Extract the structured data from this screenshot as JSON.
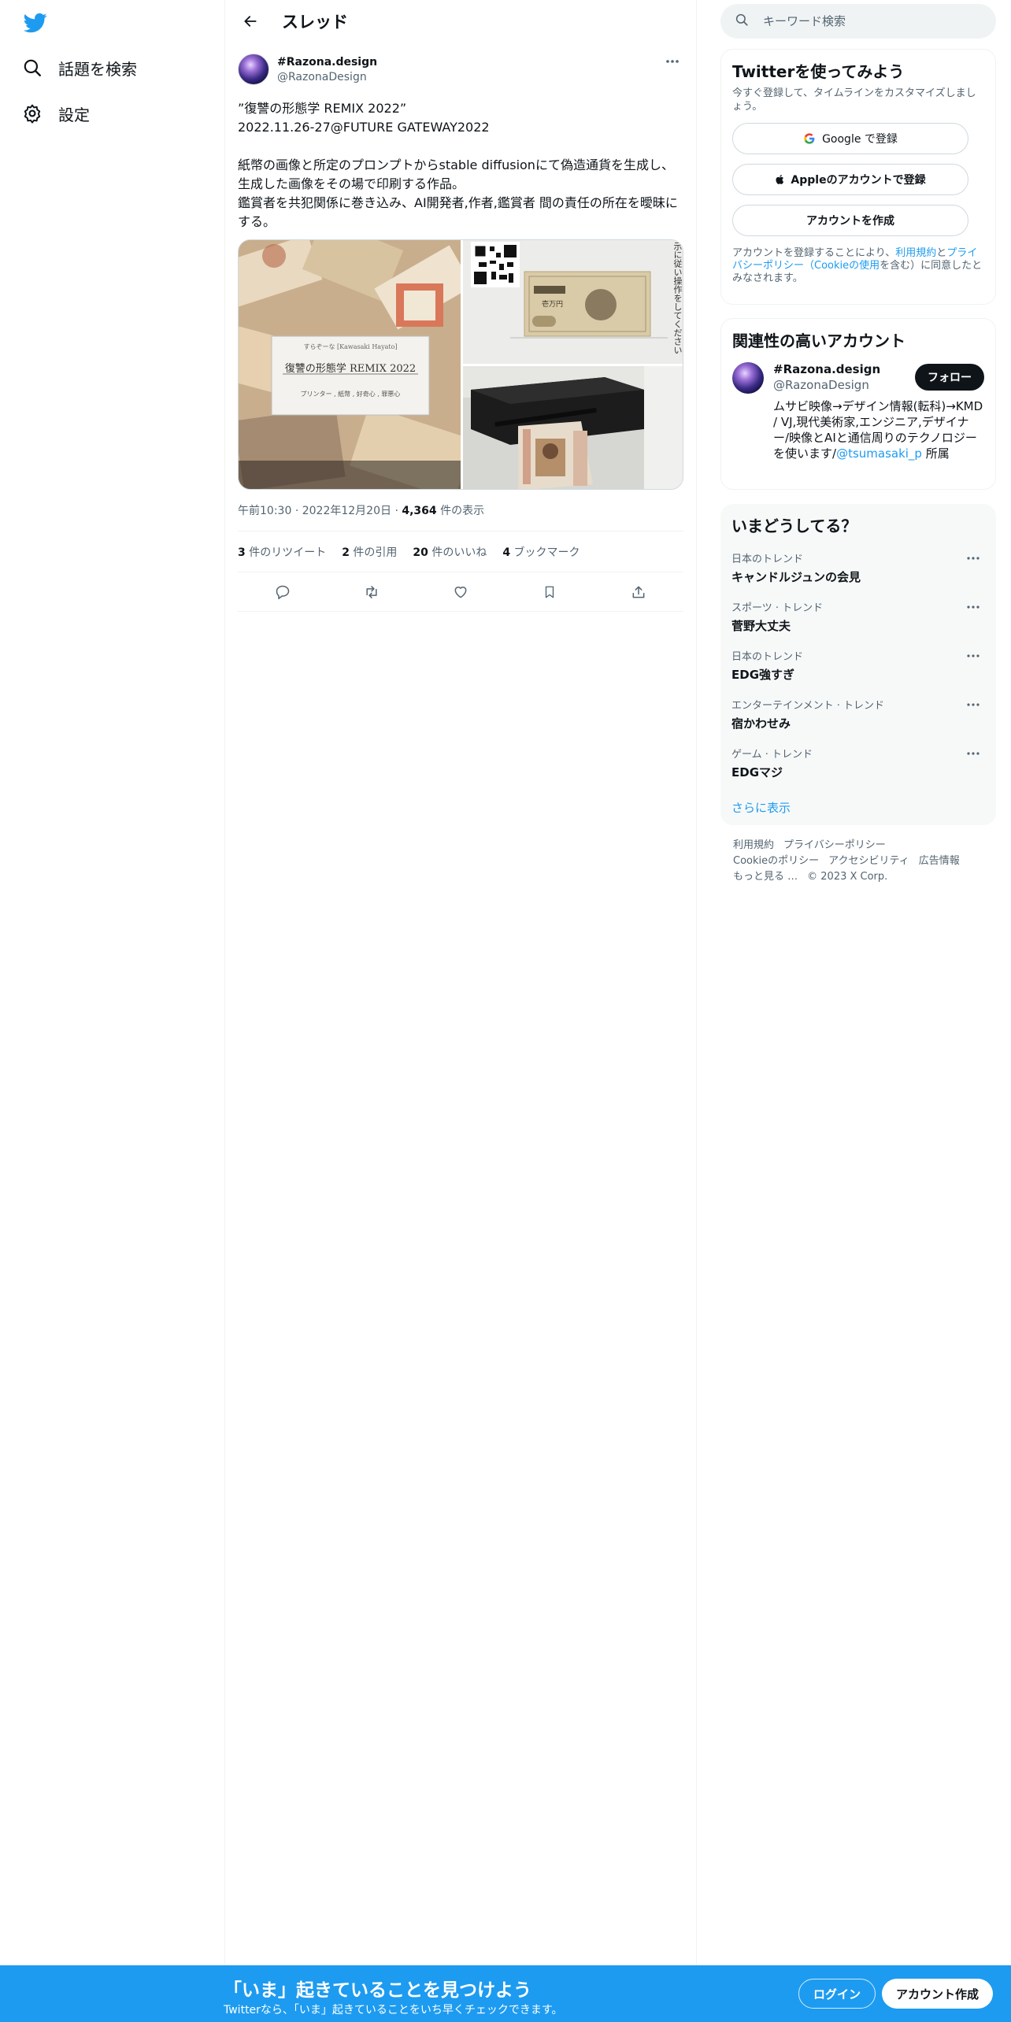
{
  "nav": {
    "explore_label": "話題を検索",
    "settings_label": "設定"
  },
  "header": {
    "title": "スレッド"
  },
  "tweet": {
    "display_name": "#Razona.design",
    "handle": "@RazonaDesign",
    "text": "”復讐の形態学 REMIX 2022”\n2022.11.26-27@FUTURE GATEWAY2022\n\n紙幣の画像と所定のプロンプトからstable diffusionにて偽造通貨を生成し、生成した画像をその場で印刷する作品。\n鑑賞者を共犯関係に巻き込み、AI開発者,作者,鑑賞者 間の責任の所在を曖昧にする。",
    "media": {
      "card_name_line": "すらぞーな [Kawasaki Hayato]",
      "card_title": "復讐の形態学 REMIX 2022",
      "card_subtitle": "プリンター , 紙幣 , 好奇心 , 罪悪心",
      "vertical_text": "示に従い操作をしてください",
      "bill_text": "壱万円"
    },
    "time": "午前10:30",
    "date": "2022年12月20日",
    "views_count": "4,364",
    "views_label": "件の表示",
    "retweets_count": "3",
    "retweets_label": "件のリツイート",
    "quotes_count": "2",
    "quotes_label": "件の引用",
    "likes_count": "20",
    "likes_label": "件のいいね",
    "bookmarks_count": "4",
    "bookmarks_label": "ブックマーク"
  },
  "sidebar": {
    "search_placeholder": "キーワード検索",
    "signup": {
      "title": "Twitterを使ってみよう",
      "desc": "今すぐ登録して、タイムラインをカスタマイズしましょう。",
      "google_label": "Google で登録",
      "apple_label": "Appleのアカウントで登録",
      "create_label": "アカウントを作成",
      "terms_prefix": "アカウントを登録することにより、",
      "terms_link": "利用規約",
      "terms_and": "と",
      "privacy_link": "プライバシーポリシー",
      "cookie_link": "（Cookieの使用",
      "terms_suffix": "を含む）に同意したとみなされます。"
    },
    "related": {
      "title": "関連性の高いアカウント",
      "name": "#Razona.design",
      "handle": "@RazonaDesign",
      "follow_label": "フォロー",
      "bio": "ムサビ映像→デザイン情報(転科)→KMD / VJ,現代美術家,エンジニア,デザイナー/映像とAIと通信周りのテクノロジーを使います/",
      "bio_link": "@tsumasaki_p",
      "bio_suffix": " 所属"
    },
    "trends": {
      "title": "いまどうしてる？",
      "items": [
        {
          "category": "日本のトレンド",
          "name": "キャンドルジュンの会見"
        },
        {
          "category": "スポーツ · トレンド",
          "name": "菅野大丈夫"
        },
        {
          "category": "日本のトレンド",
          "name": "EDG強すぎ"
        },
        {
          "category": "エンターテインメント · トレンド",
          "name": "宿かわせみ"
        },
        {
          "category": "ゲーム · トレンド",
          "name": "EDGマジ"
        }
      ],
      "show_more": "さらに表示"
    },
    "footer": {
      "terms": "利用規約",
      "privacy": "プライバシーポリシー",
      "cookie": "Cookieのポリシー",
      "accessibility": "アクセシビリティ",
      "ads": "広告情報",
      "more": "もっと見る …",
      "copyright": "© 2023 X Corp."
    }
  },
  "bottom_bar": {
    "title": "「いま」起きていることを見つけよう",
    "subtitle": "Twitterなら、「いま」起きていることをいち早くチェックできます。",
    "login_label": "ログイン",
    "signup_label": "アカウント作成"
  },
  "colors": {
    "brand": "#1d9bf0",
    "text": "#0f1419",
    "muted": "#536471"
  }
}
